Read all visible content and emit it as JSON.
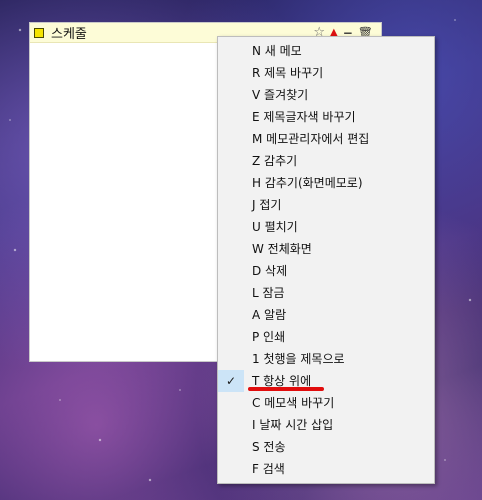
{
  "memo": {
    "title": "스케줄",
    "icons": [
      "star-outline-icon",
      "pin-icon",
      "minimize-icon",
      "trash-icon"
    ]
  },
  "menu": {
    "items": [
      {
        "label": "N 새 메모"
      },
      {
        "label": "R 제목 바꾸기"
      },
      {
        "label": "V 즐겨찾기"
      },
      {
        "label": "E 제목글자색 바꾸기"
      },
      {
        "label": "M 메모관리자에서 편집"
      },
      {
        "label": "Z 감추기"
      },
      {
        "label": "H 감추기(화면메모로)"
      },
      {
        "label": "J 접기"
      },
      {
        "label": "U 펼치기"
      },
      {
        "label": "W 전체화면"
      },
      {
        "label": "D 삭제"
      },
      {
        "label": "L 잠금"
      },
      {
        "label": "A 알람"
      },
      {
        "label": "P 인쇄"
      },
      {
        "label": "1 첫행을 제목으로"
      },
      {
        "label": "T 항상 위에",
        "checked": true,
        "check": "✓"
      },
      {
        "label": "C 메모색 바꾸기"
      },
      {
        "label": "I 날짜 시간 삽입"
      },
      {
        "label": "S 전송"
      },
      {
        "label": "F 검색"
      }
    ]
  },
  "colors": {
    "memo_titlebar": "#fdfcd7",
    "memo_square": "#f5e400",
    "menu_bg": "#f2f2f2",
    "check_highlight": "#cce4f7",
    "annotation_underline": "#e10d0d"
  }
}
